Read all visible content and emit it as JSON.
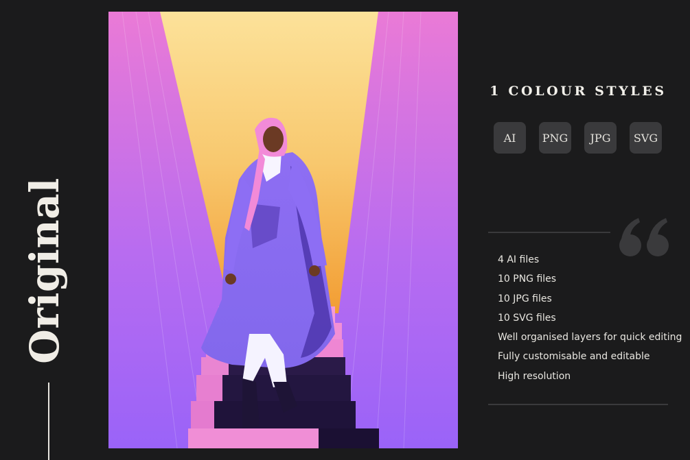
{
  "side_title": "Original",
  "colours": {
    "background": "#1b1b1c",
    "badge_background": "#3a3a3c",
    "text": "#f0ede6",
    "art_pink": "#ea7ad6",
    "art_purple": "#9a63f8",
    "art_yellow": "#fcdf93",
    "art_orange": "#f4a53f"
  },
  "artwork": {
    "description_icon": "woman-on-staircase-illustration"
  },
  "styles": {
    "heading": "1 COLOUR STYLES",
    "formats": [
      "AI",
      "PNG",
      "JPG",
      "SVG"
    ]
  },
  "quote_icon": "quotation-marks-icon",
  "features": [
    "4 AI files",
    "10 PNG files",
    "10 JPG files",
    "10 SVG files",
    "Well organised layers for quick editing",
    "Fully customisable and editable",
    "High resolution"
  ]
}
